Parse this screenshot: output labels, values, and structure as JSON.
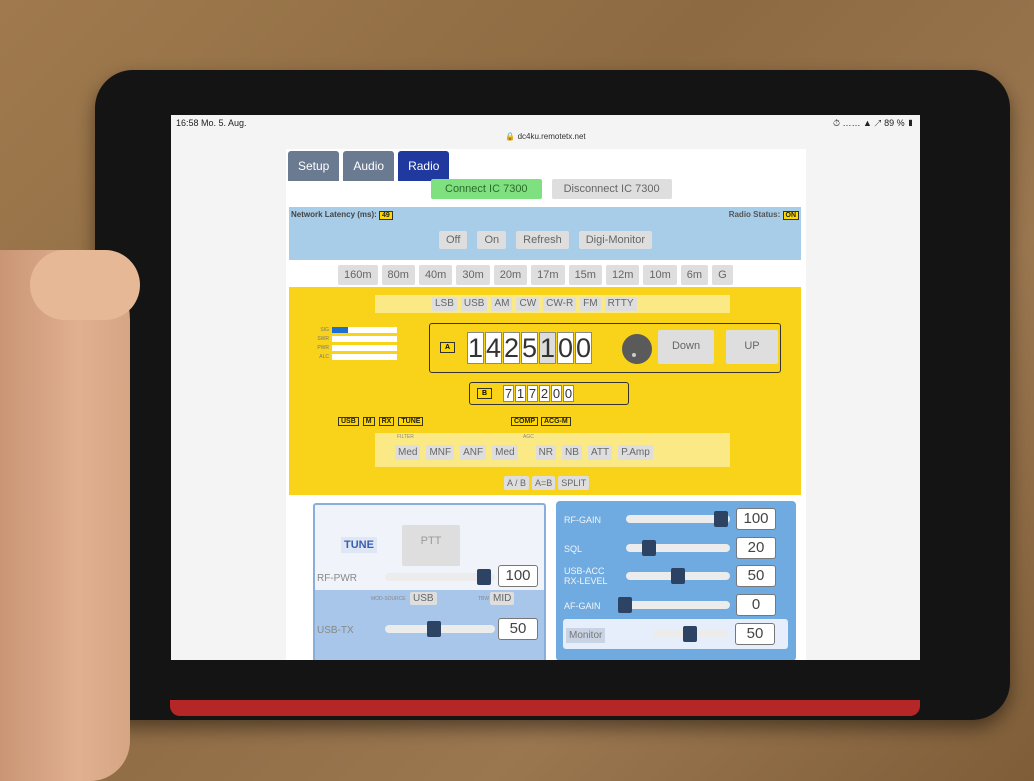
{
  "status": {
    "time": "16:58 Mo. 5. Aug.",
    "right": "⏱ …… ▲ ↗ 89 % ▮"
  },
  "url": "🔒 dc4ku.remotetx.net",
  "tabs": [
    {
      "label": "Setup"
    },
    {
      "label": "Audio"
    },
    {
      "label": "Radio"
    }
  ],
  "connect": {
    "connect_label": "Connect IC 7300",
    "disconnect_label": "Disconnect IC 7300"
  },
  "network": {
    "latency_label": "Network Latency (ms):",
    "latency_value": "49",
    "radio_status_label": "Radio Status:",
    "radio_status_value": "ON"
  },
  "power_controls": [
    "Off",
    "On",
    "Refresh",
    "Digi-Monitor"
  ],
  "bands": [
    "160m",
    "80m",
    "40m",
    "30m",
    "20m",
    "17m",
    "15m",
    "12m",
    "10m",
    "6m",
    "G"
  ],
  "modes": [
    "LSB",
    "USB",
    "AM",
    "CW",
    "CW-R",
    "FM",
    "RTTY"
  ],
  "meters": [
    {
      "label": "SIG",
      "level": 0.25
    },
    {
      "label": "SWR",
      "level": 0.0
    },
    {
      "label": "PWR",
      "level": 0.0
    },
    {
      "label": "ALC",
      "level": 0.0
    }
  ],
  "vfo_a": {
    "tag": "A",
    "digits": [
      "1",
      "4",
      "2",
      "5",
      "1",
      "0",
      "0"
    ]
  },
  "vfo_b": {
    "tag": "B",
    "digits": [
      "7",
      "1",
      "7",
      "2",
      "0",
      "0"
    ]
  },
  "tuning": {
    "down_label": "Down",
    "up_label": "UP"
  },
  "status_badges": [
    "USB",
    "M",
    "RX",
    "TUNE"
  ],
  "status_badges2": [
    "COMP",
    "ACG-M"
  ],
  "filter_labels": {
    "filter": "FILTER",
    "agc": "AGC"
  },
  "filter_buttons": [
    "Med",
    "MNF",
    "ANF",
    "Med",
    "NR",
    "NB",
    "ATT",
    "P.Amp"
  ],
  "ab_buttons": [
    "A / B",
    "A=B",
    "SPLIT"
  ],
  "tx": {
    "tune_label": "TUNE",
    "ptt_label": "PTT",
    "rf_pwr_label": "RF-PWR",
    "rf_pwr_value": "100",
    "mod_source_label": "MOD-SOURCE",
    "mod_source_value": "USB",
    "tbw_label": "TBW",
    "tbw_value": "MID",
    "usb_tx_label": "USB-TX",
    "usb_tx_value": "50"
  },
  "rx": {
    "rf_gain_label": "RF-GAIN",
    "rf_gain_value": "100",
    "sql_label": "SQL",
    "sql_value": "20",
    "usb_acc_label": "USB-ACC\nRX-LEVEL",
    "usb_acc_value": "50",
    "af_gain_label": "AF-GAIN",
    "af_gain_value": "0",
    "monitor_label": "Monitor",
    "monitor_value": "50"
  },
  "colors": {
    "tab_active": "#20399f",
    "tab_inactive": "#6a7a90",
    "connect_green": "#7fe07f",
    "radio_yellow": "#f8d319",
    "network_blue": "#a8cde8",
    "rx_blue": "#6faae0"
  }
}
